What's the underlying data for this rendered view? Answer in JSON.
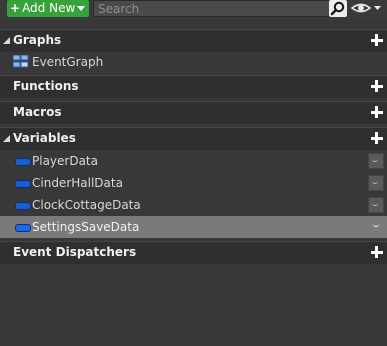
{
  "toolbar": {
    "add_new_label": "Add New",
    "search_placeholder": "Search"
  },
  "sections": {
    "graphs": "Graphs",
    "functions": "Functions",
    "macros": "Macros",
    "variables": "Variables",
    "event_dispatchers": "Event Dispatchers"
  },
  "graphs": [
    {
      "label": "EventGraph"
    }
  ],
  "variables": [
    {
      "label": "PlayerData"
    },
    {
      "label": "CinderHallData"
    },
    {
      "label": "ClockCottageData"
    },
    {
      "label": "SettingsSaveData",
      "selected": true
    }
  ],
  "colors": {
    "add_button": "#37a23a",
    "variable_pill": "#1a5dd6",
    "selected_row": "#7a7a7a"
  }
}
